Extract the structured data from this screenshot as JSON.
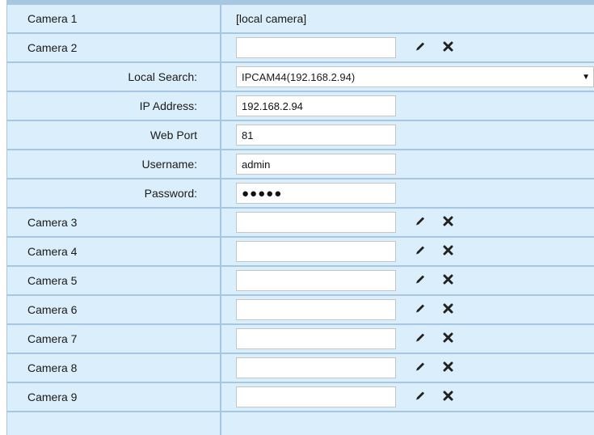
{
  "rows": [
    {
      "label": "Camera 1",
      "value": "[local camera]"
    },
    {
      "label": "Camera 2",
      "value": ""
    },
    {
      "label": "Local Search:",
      "value": "IPCAM44(192.168.2.94)"
    },
    {
      "label": "IP Address:",
      "value": "192.168.2.94"
    },
    {
      "label": "Web Port",
      "value": "81"
    },
    {
      "label": "Username:",
      "value": "admin"
    },
    {
      "label": "Password:",
      "value": "●●●●●"
    },
    {
      "label": "Camera 3",
      "value": ""
    },
    {
      "label": "Camera 4",
      "value": ""
    },
    {
      "label": "Camera 5",
      "value": ""
    },
    {
      "label": "Camera 6",
      "value": ""
    },
    {
      "label": "Camera 7",
      "value": ""
    },
    {
      "label": "Camera 8",
      "value": ""
    },
    {
      "label": "Camera 9",
      "value": ""
    }
  ],
  "icons": {
    "edit": "pencil-icon",
    "delete": "close-x-icon"
  },
  "colors": {
    "panel_bg": "#dbeefb",
    "grid_lines": "#a6c6e2"
  }
}
